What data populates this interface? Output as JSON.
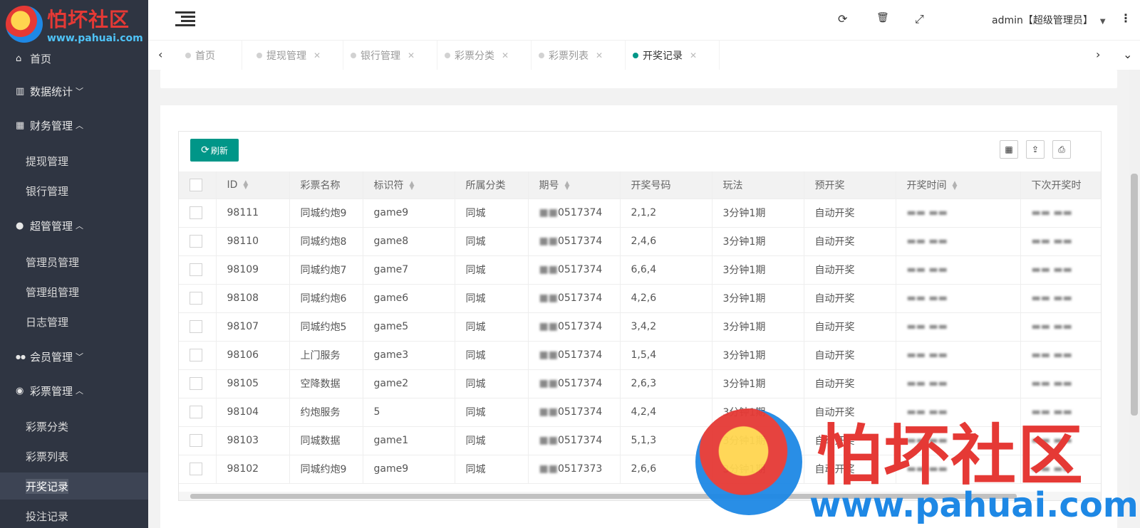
{
  "brand": {
    "title": "怕坏社区",
    "url": "www.pahuai.com"
  },
  "sidebar": {
    "items": [
      {
        "icon": "home-icon",
        "glyph": "⌂",
        "label": "首页",
        "caret": ""
      },
      {
        "icon": "bar-chart-icon",
        "glyph": "▥",
        "label": "数据统计",
        "caret": "﹀"
      },
      {
        "icon": "bank-icon",
        "glyph": "▦",
        "label": "财务管理",
        "caret": "︿"
      },
      {
        "icon": "user-icon",
        "glyph": "●",
        "label": "超管管理",
        "caret": "︿"
      },
      {
        "icon": "users-icon",
        "glyph": "●●",
        "label": "会员管理",
        "caret": "﹀"
      },
      {
        "icon": "gamepad-icon",
        "glyph": "◉",
        "label": "彩票管理",
        "caret": "︿"
      }
    ],
    "sub": {
      "finance": [
        "提现管理",
        "银行管理"
      ],
      "admin": [
        "管理员管理",
        "管理组管理",
        "日志管理"
      ],
      "lottery": [
        "彩票分类",
        "彩票列表",
        "开奖记录",
        "投注记录"
      ]
    }
  },
  "header": {
    "user": "admin【超级管理员】",
    "icons": {
      "refresh": "⟳",
      "trash": "🗑",
      "fullscreen": "⤢",
      "more": "⋮"
    }
  },
  "tabs": [
    {
      "label": "首页",
      "closable": false,
      "active": false
    },
    {
      "label": "提现管理",
      "closable": true,
      "active": false
    },
    {
      "label": "银行管理",
      "closable": true,
      "active": false
    },
    {
      "label": "彩票分类",
      "closable": true,
      "active": false
    },
    {
      "label": "彩票列表",
      "closable": true,
      "active": false
    },
    {
      "label": "开奖记录",
      "closable": true,
      "active": true
    }
  ],
  "toolbar": {
    "refresh_label": "刷新"
  },
  "table": {
    "columns": [
      "ID",
      "彩票名称",
      "标识符",
      "所属分类",
      "期号",
      "开奖号码",
      "玩法",
      "预开奖",
      "开奖时间",
      "下次开奖时"
    ],
    "rows": [
      [
        "98111",
        "同城约炮9",
        "game9",
        "同城",
        "0517374",
        "2,1,2",
        "3分钟1期",
        "自动开奖"
      ],
      [
        "98110",
        "同城约炮8",
        "game8",
        "同城",
        "0517374",
        "2,4,6",
        "3分钟1期",
        "自动开奖"
      ],
      [
        "98109",
        "同城约炮7",
        "game7",
        "同城",
        "0517374",
        "6,6,4",
        "3分钟1期",
        "自动开奖"
      ],
      [
        "98108",
        "同城约炮6",
        "game6",
        "同城",
        "0517374",
        "4,2,6",
        "3分钟1期",
        "自动开奖"
      ],
      [
        "98107",
        "同城约炮5",
        "game5",
        "同城",
        "0517374",
        "3,4,2",
        "3分钟1期",
        "自动开奖"
      ],
      [
        "98106",
        "上门服务",
        "game3",
        "同城",
        "0517374",
        "1,5,4",
        "3分钟1期",
        "自动开奖"
      ],
      [
        "98105",
        "空降数据",
        "game2",
        "同城",
        "0517374",
        "2,6,3",
        "3分钟1期",
        "自动开奖"
      ],
      [
        "98104",
        "约炮服务",
        "5",
        "同城",
        "0517374",
        "4,2,4",
        "3分钟1期",
        "自动开奖"
      ],
      [
        "98103",
        "同城数据",
        "game1",
        "同城",
        "0517374",
        "5,1,3",
        "3分钟1期",
        "自动开奖"
      ],
      [
        "98102",
        "同城约炮9",
        "game9",
        "同城",
        "0517373",
        "2,6,6",
        "3分钟1期",
        "自动开奖"
      ]
    ]
  },
  "colors": {
    "sidebar": "#2f3542",
    "accent": "#009688",
    "watermark_red": "#e53935",
    "watermark_blue": "#1e88e5"
  }
}
